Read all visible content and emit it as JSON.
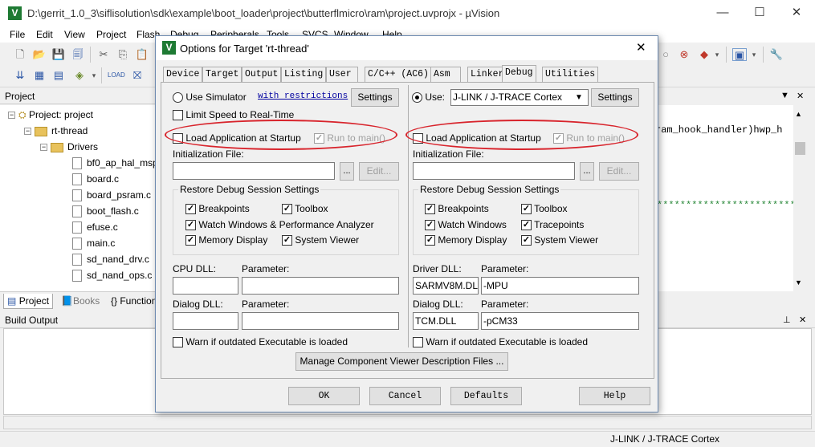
{
  "window": {
    "title": "D:\\gerrit_1.0_3\\siflisolution\\sdk\\example\\boot_loader\\project\\butterflmicro\\ram\\project.uvprojx - µVision",
    "minimize": "—",
    "maximize": "☐",
    "close": "✕"
  },
  "menu": [
    "File",
    "Edit",
    "View",
    "Project",
    "Flash",
    "Debug",
    "Peripherals",
    "Tools",
    "SVCS",
    "Window",
    "Help"
  ],
  "project_pane": {
    "title": "Project",
    "root": "Project: project",
    "target": "rt-thread",
    "folder": "Drivers",
    "files": [
      "bf0_ap_hal_msp.c",
      "board.c",
      "board_psram.c",
      "boot_flash.c",
      "efuse.c",
      "main.c",
      "sd_nand_drv.c",
      "sd_nand_ops.c"
    ],
    "tabs": [
      "Project",
      "Books",
      "{} Functions"
    ]
  },
  "editor": {
    "line1": "ram_hook_handler)hwp_h",
    "line2": "*************************"
  },
  "build_output": {
    "title": "Build Output"
  },
  "status": {
    "debugger": "J-LINK / J-TRACE Cortex"
  },
  "dialog": {
    "title": "Options for Target 'rt-thread'",
    "tabs": [
      "Device",
      "Target",
      "Output",
      "Listing",
      "User",
      "C/C++ (AC6)",
      "Asm",
      "Linker",
      "Debug",
      "Utilities"
    ],
    "active_tab": "Debug",
    "left": {
      "use_simulator": "Use Simulator",
      "with_restrictions": "with restrictions",
      "settings": "Settings",
      "limit_speed": "Limit Speed to Real-Time",
      "load_app": "Load Application at Startup",
      "run_to_main": "Run to main()",
      "init_file": "Initialization File:",
      "browse": "...",
      "edit": "Edit...",
      "restore_group": "Restore Debug Session Settings",
      "breakpoints": "Breakpoints",
      "toolbox": "Toolbox",
      "watch_windows": "Watch Windows & Performance Analyzer",
      "memory_display": "Memory Display",
      "system_viewer": "System Viewer",
      "cpu_dll": "CPU DLL:",
      "cpu_param": "Parameter:",
      "cpu_dll_value": "",
      "cpu_param_value": "",
      "dialog_dll": "Dialog DLL:",
      "dialog_param": "Parameter:",
      "dialog_dll_value": "",
      "dialog_param_value": "",
      "warn": "Warn if outdated Executable is loaded"
    },
    "right": {
      "use": "Use:",
      "debugger": "J-LINK / J-TRACE Cortex",
      "settings": "Settings",
      "load_app": "Load Application at Startup",
      "run_to_main": "Run to main()",
      "init_file": "Initialization File:",
      "browse": "...",
      "edit": "Edit...",
      "restore_group": "Restore Debug Session Settings",
      "breakpoints": "Breakpoints",
      "toolbox": "Toolbox",
      "watch_windows": "Watch Windows",
      "tracepoints": "Tracepoints",
      "memory_display": "Memory Display",
      "system_viewer": "System Viewer",
      "driver_dll": "Driver DLL:",
      "driver_param": "Parameter:",
      "driver_dll_value": "SARMV8M.DLL",
      "driver_param_value": "-MPU",
      "dialog_dll": "Dialog DLL:",
      "dialog_param": "Parameter:",
      "dialog_dll_value": "TCM.DLL",
      "dialog_param_value": "-pCM33",
      "warn": "Warn if outdated Executable is loaded"
    },
    "manage_button": "Manage Component Viewer Description Files ...",
    "ok": "OK",
    "cancel": "Cancel",
    "defaults": "Defaults",
    "help": "Help",
    "close": "✕",
    "annotation_color": "#d8242c"
  }
}
